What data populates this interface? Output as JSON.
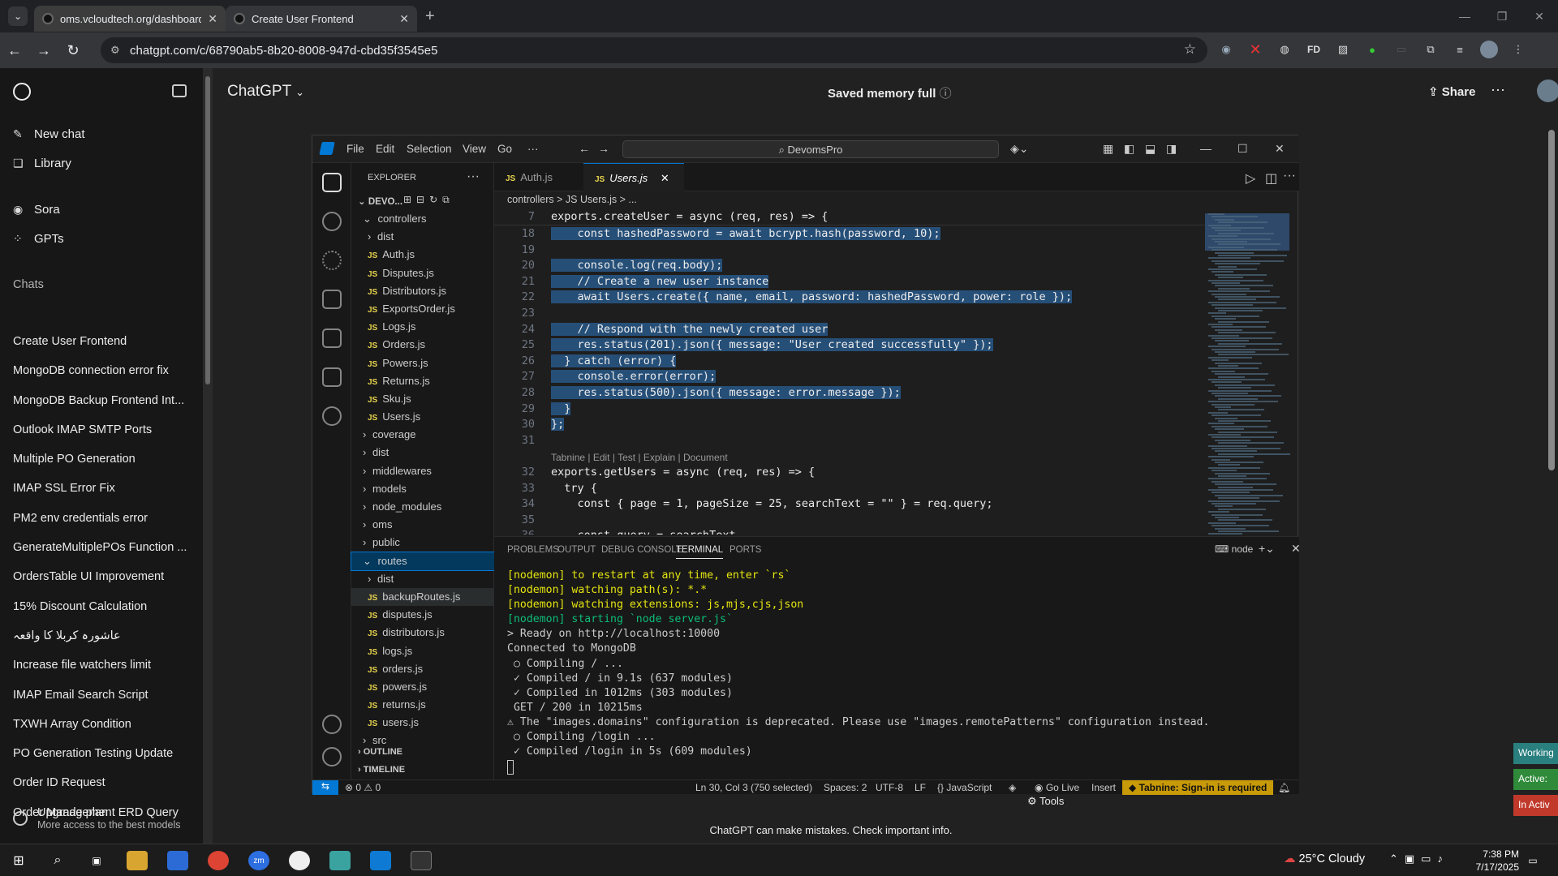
{
  "browser": {
    "tabs": [
      {
        "title": "oms.vcloudtech.org/dashboard"
      },
      {
        "title": "Create User Frontend"
      }
    ],
    "url": "chatgpt.com/c/68790ab5-8b20-8008-947d-cbd35f3545e5",
    "ext_fd": "FD"
  },
  "sidebar": {
    "new_chat": "New chat",
    "library": "Library",
    "sora": "Sora",
    "gpts": "GPTs",
    "chats_heading": "Chats",
    "chats": [
      "Create User Frontend",
      "MongoDB connection error fix",
      "MongoDB Backup Frontend Int...",
      "Outlook IMAP SMTP Ports",
      "Multiple PO Generation",
      "IMAP SSL Error Fix",
      "PM2 env credentials error",
      "GenerateMultiplePOs Function ...",
      "OrdersTable UI Improvement",
      "15% Discount Calculation",
      "عاشورہ کربلا کا واقعہ",
      "Increase file watchers limit",
      "IMAP Email Search Script",
      "TXWH Array Condition",
      "PO Generation Testing Update",
      "Order ID Request",
      "Order Management ERD Query"
    ],
    "upgrade_title": "Upgrade plan",
    "upgrade_sub": "More access to the best models"
  },
  "chat": {
    "model": "ChatGPT",
    "memory": "Saved memory full",
    "share": "Share",
    "disclaimer": "ChatGPT can make mistakes. Check important info.",
    "tools": "Tools"
  },
  "right_panel": [
    "Working",
    "Active:",
    "In Activ"
  ],
  "vscode": {
    "menu": [
      "File",
      "Edit",
      "Selection",
      "View",
      "Go",
      "···"
    ],
    "search": "DevomsPro",
    "explorer_title": "EXPLORER",
    "root": "DEVO...",
    "tree": [
      {
        "label": "controllers",
        "kind": "folder-open",
        "depth": 1
      },
      {
        "label": "dist",
        "kind": "folder",
        "depth": 2
      },
      {
        "label": "Auth.js",
        "kind": "js",
        "depth": 2
      },
      {
        "label": "Disputes.js",
        "kind": "js",
        "depth": 2
      },
      {
        "label": "Distributors.js",
        "kind": "js",
        "depth": 2
      },
      {
        "label": "ExportsOrder.js",
        "kind": "js",
        "depth": 2
      },
      {
        "label": "Logs.js",
        "kind": "js",
        "depth": 2
      },
      {
        "label": "Orders.js",
        "kind": "js",
        "depth": 2
      },
      {
        "label": "Powers.js",
        "kind": "js",
        "depth": 2
      },
      {
        "label": "Returns.js",
        "kind": "js",
        "depth": 2
      },
      {
        "label": "Sku.js",
        "kind": "js",
        "depth": 2
      },
      {
        "label": "Users.js",
        "kind": "js",
        "depth": 2
      },
      {
        "label": "coverage",
        "kind": "folder",
        "depth": 1
      },
      {
        "label": "dist",
        "kind": "folder",
        "depth": 1
      },
      {
        "label": "middlewares",
        "kind": "folder",
        "depth": 1
      },
      {
        "label": "models",
        "kind": "folder",
        "depth": 1
      },
      {
        "label": "node_modules",
        "kind": "folder",
        "depth": 1
      },
      {
        "label": "oms",
        "kind": "folder",
        "depth": 1
      },
      {
        "label": "public",
        "kind": "folder",
        "depth": 1
      },
      {
        "label": "routes",
        "kind": "folder-open",
        "depth": 1,
        "selected": true
      },
      {
        "label": "dist",
        "kind": "folder",
        "depth": 2
      },
      {
        "label": "backupRoutes.js",
        "kind": "js",
        "depth": 2,
        "hover": true
      },
      {
        "label": "disputes.js",
        "kind": "js",
        "depth": 2
      },
      {
        "label": "distributors.js",
        "kind": "js",
        "depth": 2
      },
      {
        "label": "logs.js",
        "kind": "js",
        "depth": 2
      },
      {
        "label": "orders.js",
        "kind": "js",
        "depth": 2
      },
      {
        "label": "powers.js",
        "kind": "js",
        "depth": 2
      },
      {
        "label": "returns.js",
        "kind": "js",
        "depth": 2
      },
      {
        "label": "users.js",
        "kind": "js",
        "depth": 2
      },
      {
        "label": "src",
        "kind": "folder",
        "depth": 1
      }
    ],
    "outline": "OUTLINE",
    "timeline": "TIMELINE",
    "editor_tabs": [
      "Auth.js",
      "Users.js"
    ],
    "breadcrumb": "controllers > JS Users.js > ...",
    "sticky": "exports.createUser = async (req, res) => {",
    "sticky_ln": "7",
    "code_lines": [
      {
        "n": "18",
        "text": "    const hashedPassword = await bcrypt.hash(password, 10);",
        "sel": true
      },
      {
        "n": "19",
        "text": "",
        "sel": true
      },
      {
        "n": "20",
        "text": "    console.log(req.body);",
        "sel": true
      },
      {
        "n": "21",
        "text": "    // Create a new user instance",
        "sel": true
      },
      {
        "n": "22",
        "text": "    await Users.create({ name, email, password: hashedPassword, power: role });",
        "sel": true
      },
      {
        "n": "23",
        "text": "",
        "sel": true
      },
      {
        "n": "24",
        "text": "    // Respond with the newly created user",
        "sel": true
      },
      {
        "n": "25",
        "text": "    res.status(201).json({ message: \"User created successfully\" });",
        "sel": true
      },
      {
        "n": "26",
        "text": "  } catch (error) {",
        "sel": true
      },
      {
        "n": "27",
        "text": "    console.error(error);",
        "sel": true
      },
      {
        "n": "28",
        "text": "    res.status(500).json({ message: error.message });",
        "sel": true
      },
      {
        "n": "29",
        "text": "  }",
        "sel": true
      },
      {
        "n": "30",
        "text": "};",
        "sel": true
      },
      {
        "n": "31",
        "text": "",
        "sel": false
      },
      {
        "n": "",
        "text": "Tabnine | Edit | Test | Explain | Document",
        "lens": true
      },
      {
        "n": "32",
        "text": "exports.getUsers = async (req, res) => {",
        "sel": false
      },
      {
        "n": "33",
        "text": "  try {",
        "sel": false
      },
      {
        "n": "34",
        "text": "    const { page = 1, pageSize = 25, searchText = \"\" } = req.query;",
        "sel": false
      },
      {
        "n": "35",
        "text": "",
        "sel": false
      },
      {
        "n": "36",
        "text": "    const query = searchText",
        "sel": false
      }
    ],
    "panel_tabs": [
      "PROBLEMS",
      "OUTPUT",
      "DEBUG CONSOLE",
      "TERMINAL",
      "PORTS"
    ],
    "terminal_shell": "node",
    "terminal": [
      {
        "cls": "ty",
        "text": "[nodemon] to restart at any time, enter `rs`"
      },
      {
        "cls": "ty",
        "text": "[nodemon] watching path(s): *.*"
      },
      {
        "cls": "ty",
        "text": "[nodemon] watching extensions: js,mjs,cjs,json"
      },
      {
        "cls": "tgr",
        "text": "[nodemon] starting `node server.js`"
      },
      {
        "cls": "",
        "text": "> Ready on http://localhost:10000"
      },
      {
        "cls": "",
        "text": "Connected to MongoDB"
      },
      {
        "cls": "",
        "text": " ○ Compiling / ..."
      },
      {
        "cls": "",
        "text": " ✓ Compiled / in 9.1s (637 modules)"
      },
      {
        "cls": "",
        "text": " ✓ Compiled in 1012ms (303 modules)"
      },
      {
        "cls": "",
        "text": " GET / 200 in 10215ms"
      },
      {
        "cls": "",
        "text": "⚠ The \"images.domains\" configuration is deprecated. Please use \"images.remotePatterns\" configuration instead."
      },
      {
        "cls": "",
        "text": " ○ Compiling /login ..."
      },
      {
        "cls": "",
        "text": " ✓ Compiled /login in 5s (609 modules)"
      }
    ],
    "status": {
      "problems": "⊗ 0 ⚠ 0",
      "position": "Ln 30, Col 3 (750 selected)",
      "spaces": "Spaces: 2",
      "encoding": "UTF-8",
      "eol": "LF",
      "language": "{} JavaScript",
      "golive": "Go Live",
      "insert": "Insert",
      "tabnine": "Tabnine: Sign-in is required"
    }
  },
  "taskbar": {
    "weather": "25°C  Cloudy",
    "time": "7:38 PM",
    "date": "7/17/2025"
  }
}
